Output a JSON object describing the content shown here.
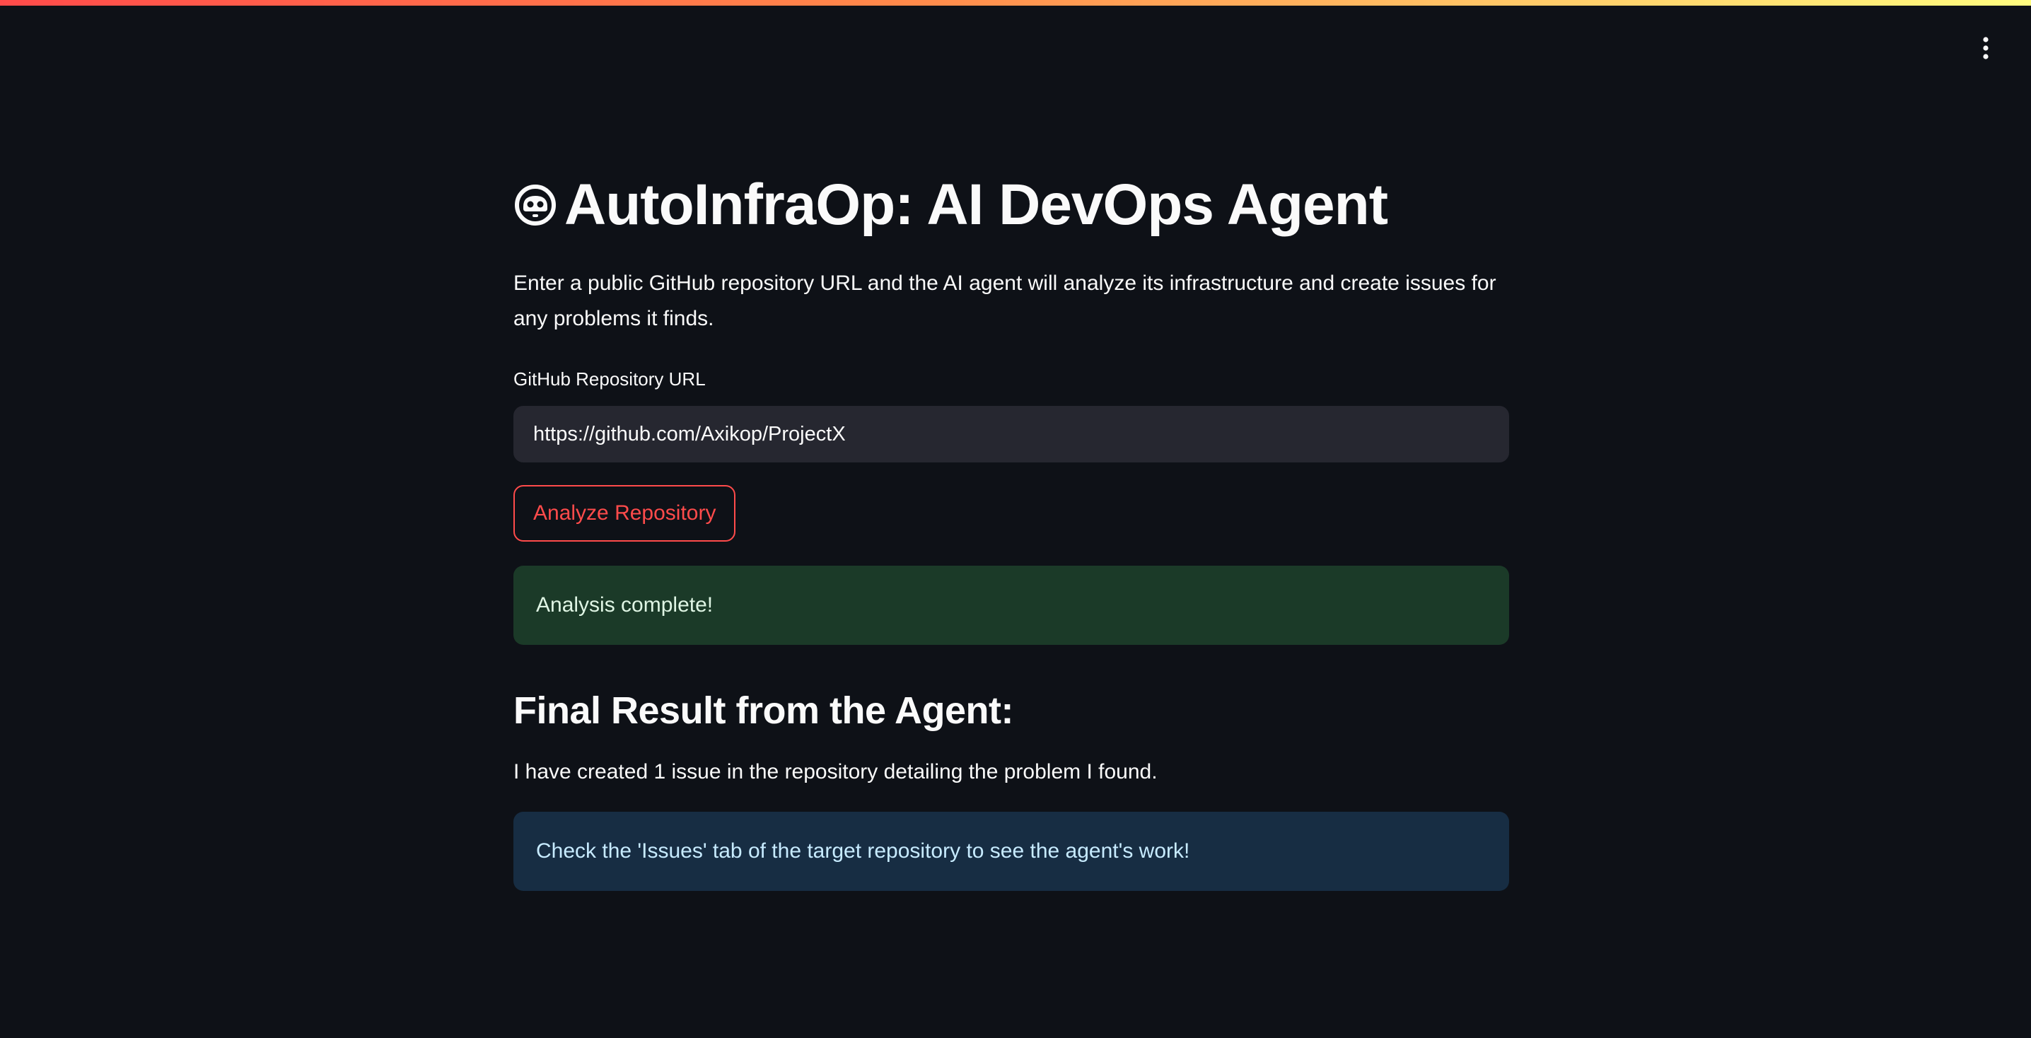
{
  "header": {
    "menu_icon": "vertical-ellipsis-icon"
  },
  "main": {
    "title_icon": "robot-face-icon",
    "title": "AutoInfraOp: AI DevOps Agent",
    "description": "Enter a public GitHub repository URL and the AI agent will analyze its infrastructure and create issues for any problems it finds.",
    "repo_field": {
      "label": "GitHub Repository URL",
      "value": "https://github.com/Axikop/ProjectX"
    },
    "analyze_button_label": "Analyze Repository",
    "success_message": "Analysis complete!",
    "result_heading": "Final Result from the Agent:",
    "result_text": "I have created 1 issue in the repository detailing the problem I found.",
    "info_message": "Check the 'Issues' tab of the target repository to see the agent's work!"
  },
  "colors": {
    "background": "#0e1117",
    "accent": "#ff4b4b",
    "input_background": "#262730",
    "success_background": "#1b3a28",
    "info_background": "#172d43"
  }
}
